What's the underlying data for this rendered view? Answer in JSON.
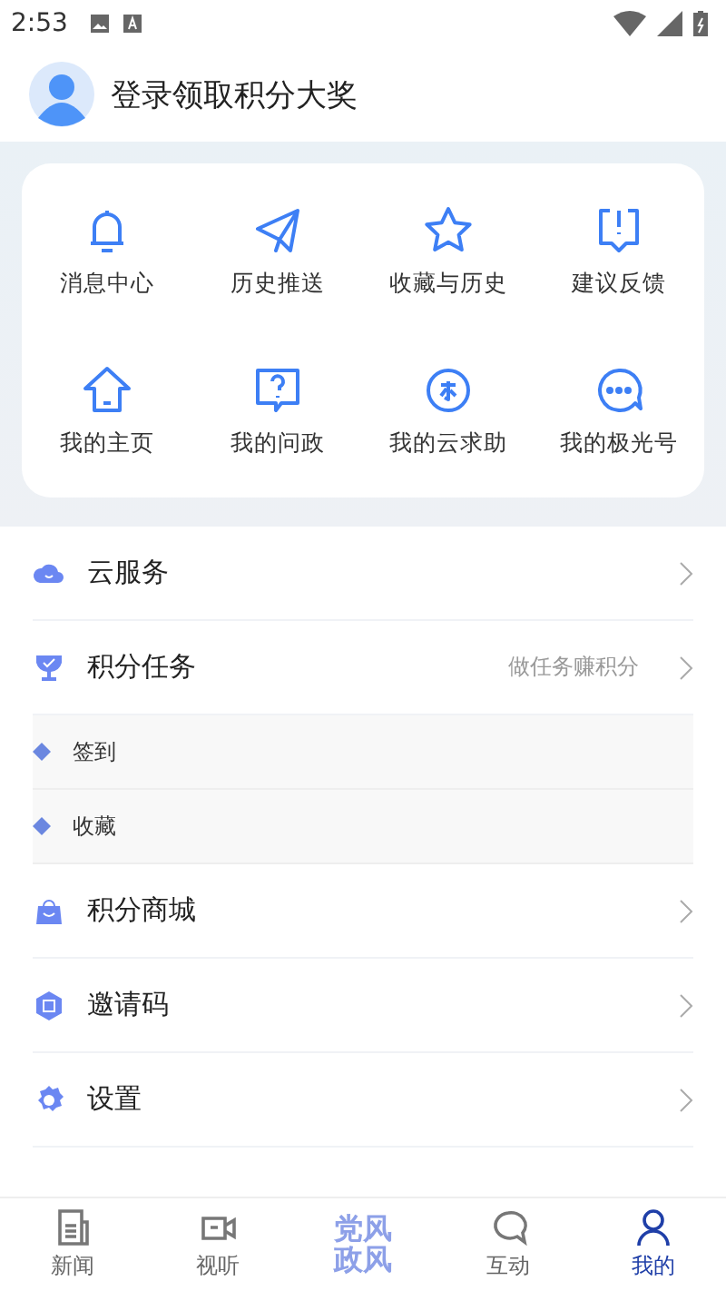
{
  "status_bar": {
    "time": "2:53"
  },
  "header": {
    "title": "登录领取积分大奖"
  },
  "shortcuts": [
    {
      "label": "消息中心",
      "kind": "bell"
    },
    {
      "label": "历史推送",
      "kind": "plane"
    },
    {
      "label": "收藏与历史",
      "kind": "star"
    },
    {
      "label": "建议反馈",
      "kind": "feedback"
    },
    {
      "label": "我的主页",
      "kind": "home"
    },
    {
      "label": "我的问政",
      "kind": "question"
    },
    {
      "label": "我的云求助",
      "kind": "help"
    },
    {
      "label": "我的极光号",
      "kind": "chat"
    }
  ],
  "menu": [
    {
      "kind": "cloud",
      "label": "云服务"
    },
    {
      "kind": "trophy",
      "label": "积分任务",
      "hint": "做任务赚积分"
    },
    {
      "kind": "sub",
      "label": "签到"
    },
    {
      "kind": "sub",
      "label": "收藏"
    },
    {
      "kind": "bag",
      "label": "积分商城"
    },
    {
      "kind": "hex",
      "label": "邀请码"
    },
    {
      "kind": "gear",
      "label": "设置"
    }
  ],
  "tabs": [
    {
      "label": "新闻",
      "kind": "news",
      "selected": false
    },
    {
      "label": "视听",
      "kind": "video",
      "selected": false
    },
    {
      "label": "党风政风",
      "kind": "logo",
      "selected": false
    },
    {
      "label": "互动",
      "kind": "chat",
      "selected": false
    },
    {
      "label": "我的",
      "kind": "user",
      "selected": true
    }
  ]
}
